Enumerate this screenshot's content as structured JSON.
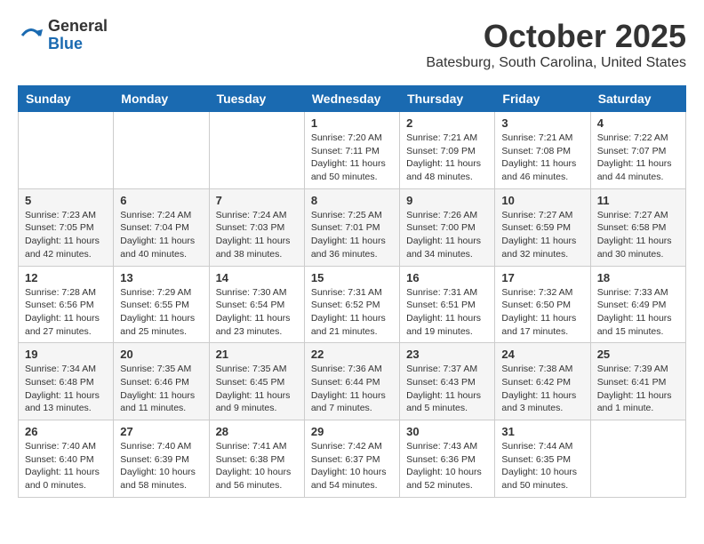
{
  "logo": {
    "general": "General",
    "blue": "Blue"
  },
  "header": {
    "month": "October 2025",
    "location": "Batesburg, South Carolina, United States"
  },
  "weekdays": [
    "Sunday",
    "Monday",
    "Tuesday",
    "Wednesday",
    "Thursday",
    "Friday",
    "Saturday"
  ],
  "weeks": [
    [
      {
        "day": "",
        "info": ""
      },
      {
        "day": "",
        "info": ""
      },
      {
        "day": "",
        "info": ""
      },
      {
        "day": "1",
        "info": "Sunrise: 7:20 AM\nSunset: 7:11 PM\nDaylight: 11 hours\nand 50 minutes."
      },
      {
        "day": "2",
        "info": "Sunrise: 7:21 AM\nSunset: 7:09 PM\nDaylight: 11 hours\nand 48 minutes."
      },
      {
        "day": "3",
        "info": "Sunrise: 7:21 AM\nSunset: 7:08 PM\nDaylight: 11 hours\nand 46 minutes."
      },
      {
        "day": "4",
        "info": "Sunrise: 7:22 AM\nSunset: 7:07 PM\nDaylight: 11 hours\nand 44 minutes."
      }
    ],
    [
      {
        "day": "5",
        "info": "Sunrise: 7:23 AM\nSunset: 7:05 PM\nDaylight: 11 hours\nand 42 minutes."
      },
      {
        "day": "6",
        "info": "Sunrise: 7:24 AM\nSunset: 7:04 PM\nDaylight: 11 hours\nand 40 minutes."
      },
      {
        "day": "7",
        "info": "Sunrise: 7:24 AM\nSunset: 7:03 PM\nDaylight: 11 hours\nand 38 minutes."
      },
      {
        "day": "8",
        "info": "Sunrise: 7:25 AM\nSunset: 7:01 PM\nDaylight: 11 hours\nand 36 minutes."
      },
      {
        "day": "9",
        "info": "Sunrise: 7:26 AM\nSunset: 7:00 PM\nDaylight: 11 hours\nand 34 minutes."
      },
      {
        "day": "10",
        "info": "Sunrise: 7:27 AM\nSunset: 6:59 PM\nDaylight: 11 hours\nand 32 minutes."
      },
      {
        "day": "11",
        "info": "Sunrise: 7:27 AM\nSunset: 6:58 PM\nDaylight: 11 hours\nand 30 minutes."
      }
    ],
    [
      {
        "day": "12",
        "info": "Sunrise: 7:28 AM\nSunset: 6:56 PM\nDaylight: 11 hours\nand 27 minutes."
      },
      {
        "day": "13",
        "info": "Sunrise: 7:29 AM\nSunset: 6:55 PM\nDaylight: 11 hours\nand 25 minutes."
      },
      {
        "day": "14",
        "info": "Sunrise: 7:30 AM\nSunset: 6:54 PM\nDaylight: 11 hours\nand 23 minutes."
      },
      {
        "day": "15",
        "info": "Sunrise: 7:31 AM\nSunset: 6:52 PM\nDaylight: 11 hours\nand 21 minutes."
      },
      {
        "day": "16",
        "info": "Sunrise: 7:31 AM\nSunset: 6:51 PM\nDaylight: 11 hours\nand 19 minutes."
      },
      {
        "day": "17",
        "info": "Sunrise: 7:32 AM\nSunset: 6:50 PM\nDaylight: 11 hours\nand 17 minutes."
      },
      {
        "day": "18",
        "info": "Sunrise: 7:33 AM\nSunset: 6:49 PM\nDaylight: 11 hours\nand 15 minutes."
      }
    ],
    [
      {
        "day": "19",
        "info": "Sunrise: 7:34 AM\nSunset: 6:48 PM\nDaylight: 11 hours\nand 13 minutes."
      },
      {
        "day": "20",
        "info": "Sunrise: 7:35 AM\nSunset: 6:46 PM\nDaylight: 11 hours\nand 11 minutes."
      },
      {
        "day": "21",
        "info": "Sunrise: 7:35 AM\nSunset: 6:45 PM\nDaylight: 11 hours\nand 9 minutes."
      },
      {
        "day": "22",
        "info": "Sunrise: 7:36 AM\nSunset: 6:44 PM\nDaylight: 11 hours\nand 7 minutes."
      },
      {
        "day": "23",
        "info": "Sunrise: 7:37 AM\nSunset: 6:43 PM\nDaylight: 11 hours\nand 5 minutes."
      },
      {
        "day": "24",
        "info": "Sunrise: 7:38 AM\nSunset: 6:42 PM\nDaylight: 11 hours\nand 3 minutes."
      },
      {
        "day": "25",
        "info": "Sunrise: 7:39 AM\nSunset: 6:41 PM\nDaylight: 11 hours\nand 1 minute."
      }
    ],
    [
      {
        "day": "26",
        "info": "Sunrise: 7:40 AM\nSunset: 6:40 PM\nDaylight: 11 hours\nand 0 minutes."
      },
      {
        "day": "27",
        "info": "Sunrise: 7:40 AM\nSunset: 6:39 PM\nDaylight: 10 hours\nand 58 minutes."
      },
      {
        "day": "28",
        "info": "Sunrise: 7:41 AM\nSunset: 6:38 PM\nDaylight: 10 hours\nand 56 minutes."
      },
      {
        "day": "29",
        "info": "Sunrise: 7:42 AM\nSunset: 6:37 PM\nDaylight: 10 hours\nand 54 minutes."
      },
      {
        "day": "30",
        "info": "Sunrise: 7:43 AM\nSunset: 6:36 PM\nDaylight: 10 hours\nand 52 minutes."
      },
      {
        "day": "31",
        "info": "Sunrise: 7:44 AM\nSunset: 6:35 PM\nDaylight: 10 hours\nand 50 minutes."
      },
      {
        "day": "",
        "info": ""
      }
    ]
  ]
}
